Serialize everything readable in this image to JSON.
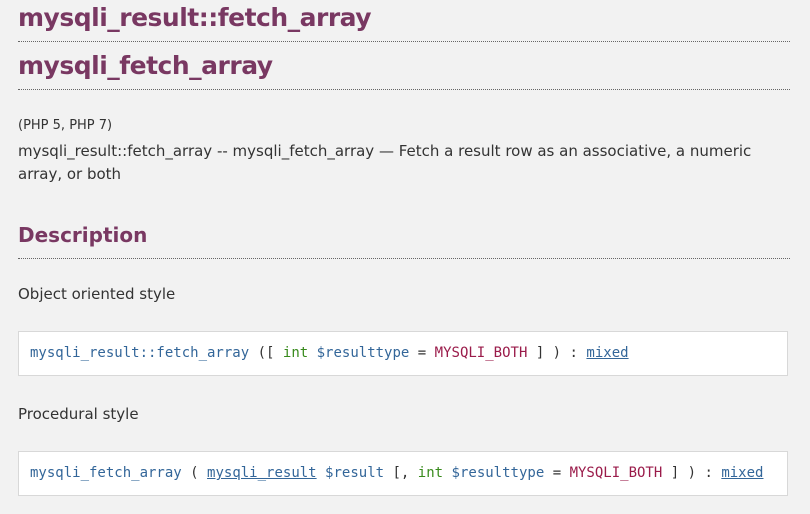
{
  "headings": {
    "title_method": "mysqli_result::fetch_array",
    "title_function": "mysqli_fetch_array"
  },
  "versions": "(PHP 5, PHP 7)",
  "refpurpose": "mysqli_result::fetch_array -- mysqli_fetch_array — Fetch a result row as an associative, a numeric array, or both",
  "description": {
    "heading": "Description",
    "oo_label": "Object oriented style",
    "procedural_label": "Procedural style"
  },
  "signature_oo": {
    "method": "mysqli_result::fetch_array",
    "open": "([",
    "param_type": "int",
    "param_var": "$resulttype",
    "equals": "=",
    "default": "MYSQLI_BOTH",
    "close": "] )",
    "colon": ":",
    "return_type": "mixed"
  },
  "signature_proc": {
    "method": "mysqli_fetch_array",
    "open": "(",
    "param1_type": "mysqli_result",
    "param1_var": "$result",
    "open_opt": "[,",
    "param2_type": "int",
    "param2_var": "$resulttype",
    "equals": "=",
    "default": "MYSQLI_BOTH",
    "close": "] )",
    "colon": ":",
    "return_type": "mixed"
  },
  "colors": {
    "heading": "#793862",
    "function": "#336699",
    "type": "#388a1c",
    "constant": "#9a1b4a",
    "background": "#f2f2f2",
    "box": "#ffffff"
  }
}
